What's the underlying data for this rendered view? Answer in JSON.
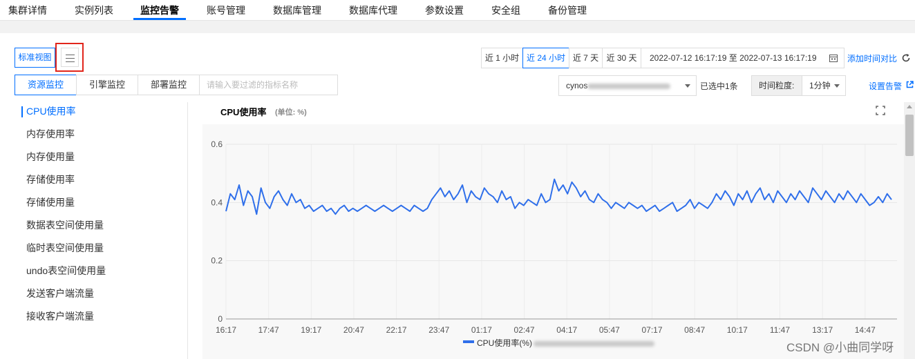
{
  "nav": {
    "tabs": [
      "集群详情",
      "实例列表",
      "监控告警",
      "账号管理",
      "数据库管理",
      "数据库代理",
      "参数设置",
      "安全组",
      "备份管理"
    ],
    "active_index": 2
  },
  "view": {
    "standard_label": "标准视图"
  },
  "time_range": {
    "options": [
      "近 1 小时",
      "近 24 小时",
      "近 7 天",
      "近 30 天"
    ],
    "active_index": 1,
    "range_text": "2022-07-12 16:17:19 至 2022-07-13 16:17:19",
    "compare_link": "添加时间对比"
  },
  "monitor_tabs": {
    "items": [
      "资源监控",
      "引擎监控",
      "部署监控"
    ],
    "active_index": 0
  },
  "filter": {
    "placeholder": "请输入要过滤的指标名称"
  },
  "instance_select": {
    "value_prefix": "cynos",
    "selected_count": "已选中1条"
  },
  "granularity": {
    "label": "时间粒度:",
    "value": "1分钟"
  },
  "alarm_link": "设置告警",
  "sidebar": {
    "items": [
      "CPU使用率",
      "内存使用率",
      "内存使用量",
      "存储使用率",
      "存储使用量",
      "数据表空间使用量",
      "临时表空间使用量",
      "undo表空间使用量",
      "发送客户端流量",
      "接收客户端流量"
    ],
    "active_index": 0
  },
  "chart_header": {
    "title": "CPU使用率",
    "unit": "(单位: %)"
  },
  "watermark": "CSDN @小曲同学呀",
  "colors": {
    "accent": "#006eff",
    "series": "#2f6fea",
    "highlight": "#e1251b"
  },
  "chart_data": {
    "type": "line",
    "title": "CPU使用率",
    "unit": "%",
    "ylim": [
      0,
      0.6
    ],
    "y_ticks": [
      0,
      0.2,
      0.4,
      0.6
    ],
    "x_ticks": [
      "16:17",
      "17:47",
      "19:17",
      "20:47",
      "22:17",
      "23:47",
      "01:17",
      "02:47",
      "04:17",
      "05:47",
      "07:17",
      "08:47",
      "10:17",
      "11:47",
      "13:17",
      "14:47"
    ],
    "grid": true,
    "legend_position": "bottom",
    "series": [
      {
        "name": "CPU使用率(%)",
        "values": [
          0.37,
          0.43,
          0.41,
          0.46,
          0.39,
          0.44,
          0.42,
          0.36,
          0.45,
          0.4,
          0.38,
          0.42,
          0.44,
          0.41,
          0.39,
          0.43,
          0.4,
          0.41,
          0.38,
          0.39,
          0.37,
          0.38,
          0.39,
          0.37,
          0.38,
          0.36,
          0.38,
          0.39,
          0.37,
          0.38,
          0.37,
          0.38,
          0.39,
          0.38,
          0.37,
          0.38,
          0.39,
          0.38,
          0.37,
          0.38,
          0.39,
          0.38,
          0.37,
          0.39,
          0.38,
          0.37,
          0.38,
          0.41,
          0.43,
          0.45,
          0.42,
          0.44,
          0.41,
          0.43,
          0.46,
          0.4,
          0.44,
          0.42,
          0.41,
          0.45,
          0.43,
          0.42,
          0.4,
          0.44,
          0.41,
          0.42,
          0.38,
          0.4,
          0.39,
          0.41,
          0.4,
          0.39,
          0.43,
          0.4,
          0.41,
          0.48,
          0.44,
          0.46,
          0.43,
          0.47,
          0.45,
          0.42,
          0.44,
          0.41,
          0.4,
          0.43,
          0.41,
          0.4,
          0.38,
          0.4,
          0.39,
          0.38,
          0.4,
          0.39,
          0.38,
          0.39,
          0.37,
          0.38,
          0.39,
          0.37,
          0.38,
          0.39,
          0.4,
          0.37,
          0.38,
          0.39,
          0.41,
          0.38,
          0.4,
          0.39,
          0.38,
          0.4,
          0.43,
          0.41,
          0.44,
          0.42,
          0.39,
          0.43,
          0.41,
          0.44,
          0.4,
          0.43,
          0.45,
          0.41,
          0.43,
          0.4,
          0.44,
          0.42,
          0.4,
          0.43,
          0.41,
          0.44,
          0.42,
          0.4,
          0.45,
          0.43,
          0.41,
          0.44,
          0.42,
          0.4,
          0.43,
          0.41,
          0.44,
          0.42,
          0.4,
          0.43,
          0.41,
          0.39,
          0.4,
          0.42,
          0.4,
          0.43,
          0.41
        ]
      }
    ]
  }
}
